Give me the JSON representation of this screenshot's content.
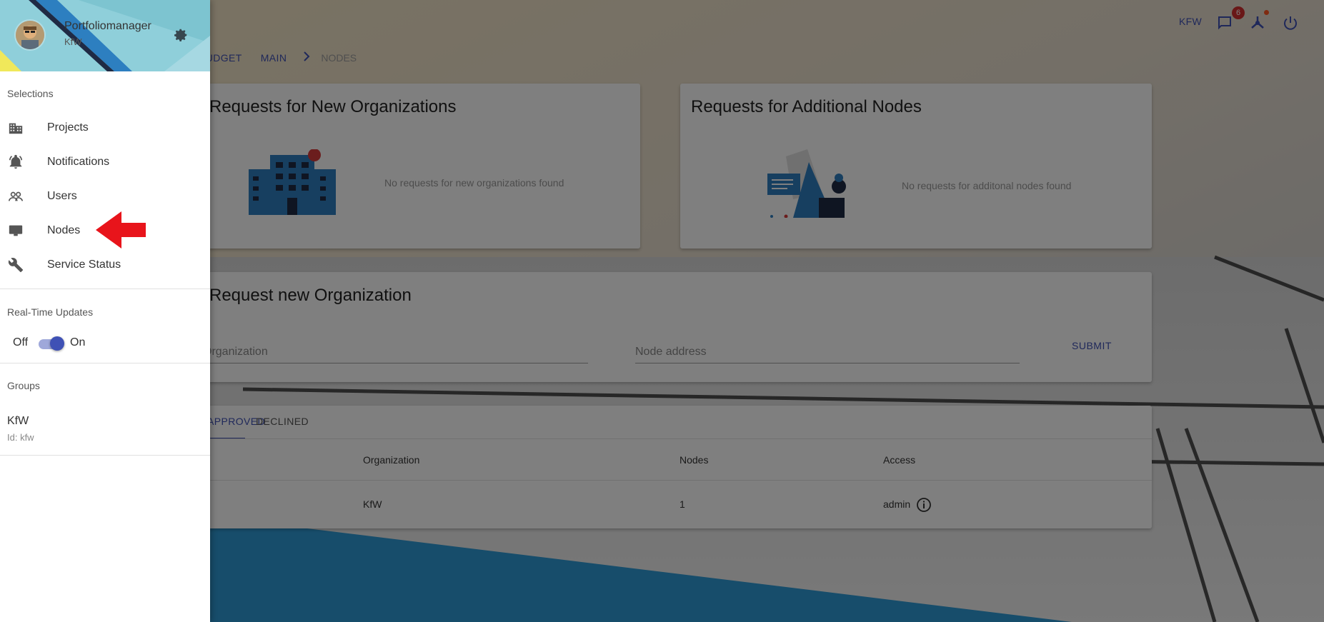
{
  "header": {
    "brand": "KFW",
    "notification_count": "6",
    "icons": [
      "chat-icon",
      "network-icon",
      "power-icon"
    ]
  },
  "breadcrumb": {
    "items": [
      "BUDGET",
      "MAIN"
    ],
    "current": "NODES"
  },
  "cards": {
    "new_org_requests": {
      "title": "Requests for New Organizations",
      "empty": "No requests for new organizations found"
    },
    "additional_node_requests": {
      "title": "Requests for Additional Nodes",
      "empty": "No requests for additonal nodes found"
    }
  },
  "new_org_form": {
    "title": "Request new Organization",
    "organization_placeholder": "Organization",
    "node_address_placeholder": "Node address",
    "submit_label": "SUBMIT"
  },
  "tabs": [
    {
      "label": "APPROVED",
      "active": true
    },
    {
      "label": "DECLINED",
      "active": false
    }
  ],
  "table": {
    "headers": [
      "Organization",
      "Nodes",
      "Access"
    ],
    "rows": [
      {
        "organization": "KfW",
        "nodes": "1",
        "access": "admin"
      }
    ]
  },
  "drawer": {
    "user": {
      "name": "Portfoliomanager",
      "org": "KfW"
    },
    "selections_label": "Selections",
    "items": [
      {
        "label": "Projects",
        "icon": "building-icon"
      },
      {
        "label": "Notifications",
        "icon": "bell-icon"
      },
      {
        "label": "Users",
        "icon": "users-icon"
      },
      {
        "label": "Nodes",
        "icon": "desktop-icon"
      },
      {
        "label": "Service Status",
        "icon": "wrench-icon"
      }
    ],
    "realtime": {
      "label": "Real-Time Updates",
      "off": "Off",
      "on": "On",
      "enabled": true
    },
    "groups": {
      "label": "Groups",
      "name": "KfW",
      "id": "Id: kfw"
    }
  },
  "colors": {
    "primary": "#3f51b5",
    "badge": "#d32f2f",
    "annotation_arrow": "#e8141b"
  }
}
